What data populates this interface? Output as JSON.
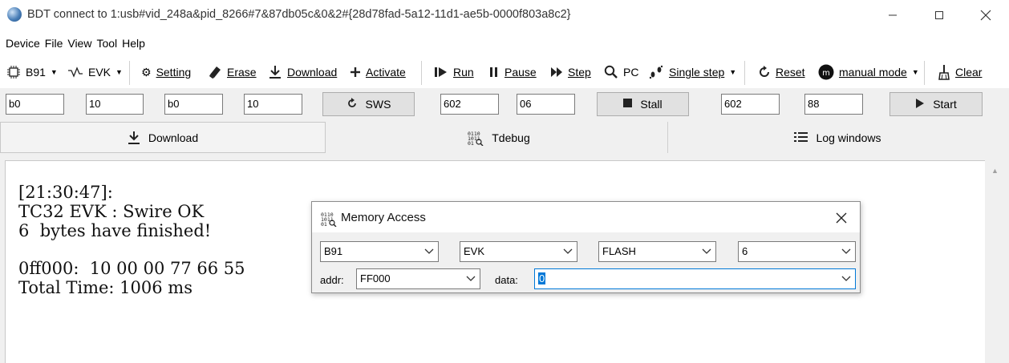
{
  "window": {
    "title": "BDT connect to 1:usb#vid_248a&pid_8266#7&87db05c&0&2#{28d78fad-5a12-11d1-ae5b-0000f803a8c2}"
  },
  "menu": [
    "Device",
    "File",
    "View",
    "Tool",
    "Help"
  ],
  "toolbar": {
    "chip": "B91",
    "board": "EVK",
    "setting": "Setting",
    "erase": "Erase",
    "download": "Download",
    "activate": "Activate",
    "run": "Run",
    "pause": "Pause",
    "step": "Step",
    "pc": "PC",
    "single_step": "Single step",
    "reset": "Reset",
    "mode": "manual mode",
    "clear": "Clear"
  },
  "inputs": {
    "f1": "b0",
    "f2": "10",
    "f3": "b0",
    "f4": "10",
    "sws": "SWS",
    "f5": "602",
    "f6": "06",
    "stall": "Stall",
    "f7": "602",
    "f8": "88",
    "start": "Start"
  },
  "tabs": {
    "download": "Download",
    "tdebug": "Tdebug",
    "log": "Log windows"
  },
  "log": {
    "lines": [
      "[21:30:47]:",
      "TC32 EVK : Swire OK",
      "6  bytes have finished!",
      "",
      "0ff000:  10 00 00 77 66 55",
      "Total Time: 1006 ms"
    ]
  },
  "dialog": {
    "title": "Memory Access",
    "chip": "B91",
    "board": "EVK",
    "memory": "FLASH",
    "size": "6",
    "addr_label": "addr:",
    "addr": "FF000",
    "data_label": "data:",
    "data": "0"
  },
  "colors": {
    "focus_border": "#0078d7",
    "selection": "#0078d7"
  }
}
